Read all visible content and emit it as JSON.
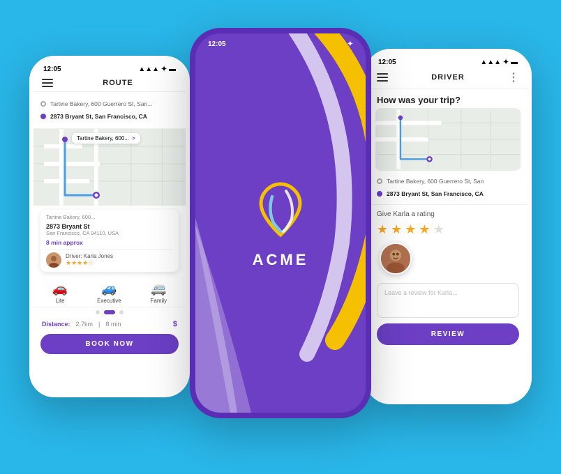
{
  "app": {
    "brand": "ACME",
    "background_color": "#29b6e8",
    "accent_color": "#6c3fc5",
    "gold_color": "#f5c000",
    "star_color": "#f5a623"
  },
  "left_phone": {
    "status_time": "12:05",
    "title": "ROUTE",
    "from_address": "Tartine Bakery, 600 Guerrero St, San...",
    "to_address": "2873 Bryant St, San Francisco, CA",
    "map_callout_from": "Tartine Bakery, 600...",
    "destination_title": "2873 Bryant St",
    "destination_sub": "San Francisco, CA 94110, USA",
    "eta": "8 min approx",
    "driver_label": "Driver: Karla Jones",
    "stars": 3.5,
    "car_types": [
      "Lite",
      "Executive",
      "Family"
    ],
    "distance_label": "Distance:",
    "distance_value": "2,7km",
    "duration": "8 min",
    "price": "$",
    "book_button": "BOOK NOW"
  },
  "center_phone": {
    "status_time": "12:05",
    "logo_text": "ACME"
  },
  "right_phone": {
    "status_time": "12:05",
    "title": "DRIVER",
    "trip_question": "How was your trip?",
    "from_address": "Tartine Bakery, 600 Guerrero St, San",
    "to_address": "2873 Bryant St, San Francisco, CA",
    "rating_title": "Give Karla a rating",
    "stars_filled": 4,
    "stars_total": 5,
    "review_placeholder": "Leave a review for Karla...",
    "review_button": "REVIEW"
  }
}
